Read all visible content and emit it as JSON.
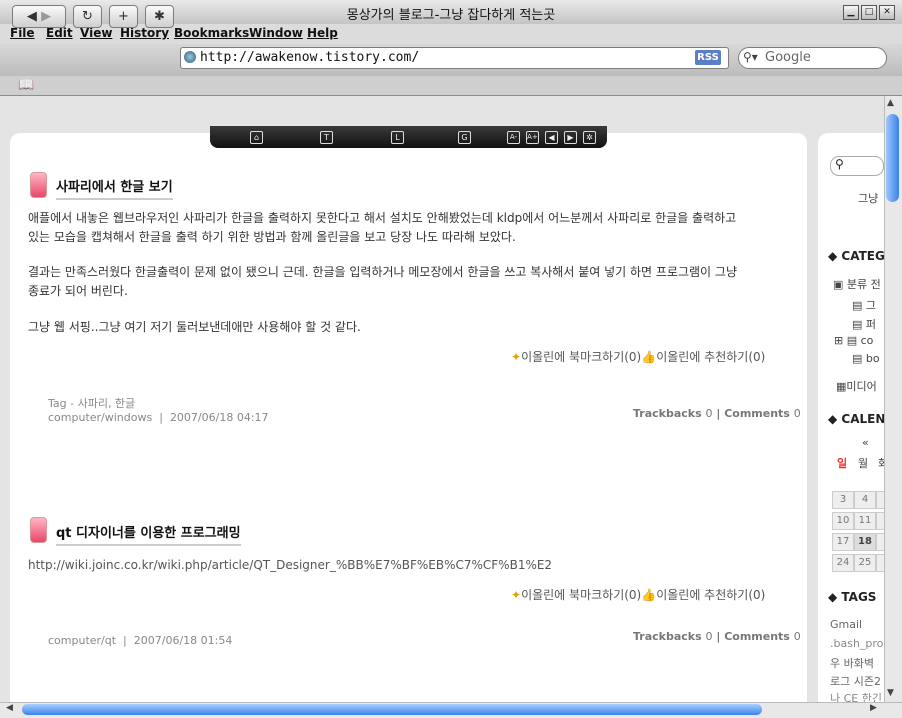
{
  "window": {
    "title": "몽상가의 블로그-그냥 잡다하게 적는곳"
  },
  "menu": [
    "File",
    "Edit",
    "View",
    "History",
    "Bookmarks",
    "Window",
    "Help"
  ],
  "toolbar": {
    "url": "http://awakenow.tistory.com/",
    "rss": "RSS",
    "search_placeholder": "Google"
  },
  "topbar_icons": [
    "T",
    "L",
    "G",
    "A-",
    "A+"
  ],
  "posts": [
    {
      "title": "사파리에서 한글 보기",
      "paragraphs": [
        "애플에서 내놓은 웹브라우저인 사파리가 한글을 출력하지 못한다고 해서 설치도 안해봤었는데 kldp에서 어느분께서 사파리로 한글을 출력하고",
        "있는 모습을 캡쳐해서 한글을 출력 하기 위한 방법과 함께 올린글을 보고 당장 나도 따라해 보았다.",
        "결과는 만족스러웠다 한글출력이 문제 없이 됐으니 근데. 한글을 입력하거나 메모장에서 한글을 쓰고 복사해서 붙여 넣기 하면 프로그램이 그냥",
        "종료가 되어 버린다.",
        "그냥 웹 서핑..그냥 여기 저기 둘러보낸데애만 사용해야 할 것 같다."
      ],
      "bookmark": "이올린에 북마크하기(0)",
      "recommend": "이올린에 추천하기(0)",
      "tag": "Tag - 사파리, 한글",
      "category": "computer/windows",
      "date": "2007/06/18 04:17",
      "trackbacks_label": "Trackbacks",
      "trackbacks": "0",
      "comments_label": "Comments",
      "comments": "0"
    },
    {
      "title": "qt 디자이너를 이용한 프로그래밍",
      "paragraphs": [
        "http://wiki.joinc.co.kr/wiki.php/article/QT_Designer_%BB%E7%BF%EB%C7%CF%B1%E2"
      ],
      "bookmark": "이올린에 북마크하기(0)",
      "recommend": "이올린에 추천하기(0)",
      "category": "computer/qt",
      "date": "2007/06/18 01:54",
      "trackbacks_label": "Trackbacks",
      "trackbacks": "0",
      "comments_label": "Comments",
      "comments": "0"
    }
  ],
  "sidebar": {
    "blog_desc": "그냥",
    "category_heading": "CATEGO",
    "category_root": "분류 전",
    "category_items": [
      "그",
      "퍼",
      "co",
      "bo"
    ],
    "media": "미디어",
    "calendar_heading": "CALEND",
    "calendar_nav": "«",
    "weekdays": [
      "일",
      "월",
      "화"
    ],
    "days": [
      "3",
      "4",
      "",
      "10",
      "11",
      "",
      "17",
      "18",
      "",
      "24",
      "25",
      ""
    ],
    "tags_heading": "TAGS",
    "tags": [
      "Gmail",
      ".bash_pro",
      "우 바화벽",
      "로그 시즌2",
      "나 CE 한긴"
    ]
  }
}
